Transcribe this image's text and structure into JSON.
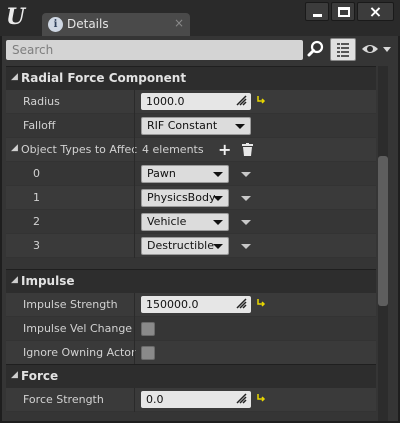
{
  "window": {
    "tab_title": "Details",
    "tab_close": "×"
  },
  "search": {
    "placeholder": "Search"
  },
  "categories": {
    "radial": "Radial Force Component",
    "impulse": "Impulse",
    "force": "Force"
  },
  "radial": {
    "radius_label": "Radius",
    "radius_value": "1000.0",
    "falloff_label": "Falloff",
    "falloff_value": "RIF Constant",
    "object_types_label": "Object Types to Affec",
    "object_types_count": "4 elements",
    "elements": [
      {
        "index": "0",
        "value": "Pawn"
      },
      {
        "index": "1",
        "value": "PhysicsBody"
      },
      {
        "index": "2",
        "value": "Vehicle"
      },
      {
        "index": "3",
        "value": "Destructible"
      }
    ]
  },
  "impulse": {
    "strength_label": "Impulse Strength",
    "strength_value": "150000.0",
    "vel_change_label": "Impulse Vel Change",
    "vel_change_checked": false,
    "ignore_owner_label": "Ignore Owning Actor",
    "ignore_owner_checked": false
  },
  "force": {
    "strength_label": "Force Strength",
    "strength_value": "0.0"
  },
  "colors": {
    "accent_reset": "#e8d600",
    "panel": "#353535",
    "category": "#2d2d2d"
  }
}
